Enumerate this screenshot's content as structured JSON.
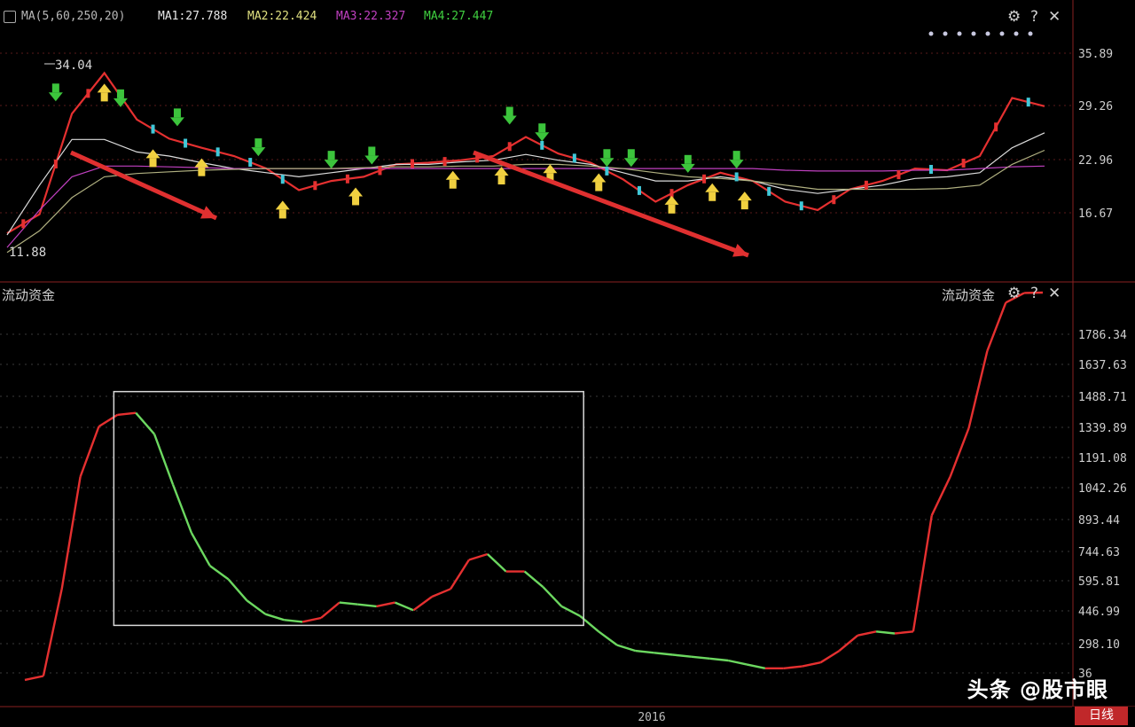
{
  "upper_panel": {
    "legend": [
      {
        "text": "MA(5,60,250,20)",
        "color": "#b8b8b8"
      },
      {
        "text": "MA1:27.788",
        "color": "#e8e8e8"
      },
      {
        "text": "MA2:22.424",
        "color": "#e0e080"
      },
      {
        "text": "MA3:22.327",
        "color": "#c040c0"
      },
      {
        "text": "MA4:27.447",
        "color": "#40d040"
      }
    ],
    "controls": {
      "settings": "⚙",
      "help": "?",
      "close": "✕"
    }
  },
  "lower_panel": {
    "indicator_left": "流动资金",
    "indicator_right": "流动资金",
    "controls": {
      "settings": "⚙",
      "help": "?",
      "close": "✕"
    }
  },
  "watermark": "头条 @股市眼",
  "bottom_tab": "日线",
  "chart_data": [
    {
      "type": "line",
      "panel": "price",
      "title": "",
      "y_ticks": [
        "35.89",
        "29.26",
        "22.96",
        "16.67"
      ],
      "annotations": [
        "34.04",
        "11.88"
      ],
      "x": [
        0,
        4,
        8,
        12,
        16,
        20,
        24,
        28,
        32,
        36,
        40,
        44,
        48,
        52,
        56,
        60,
        64,
        68,
        72,
        76,
        80,
        84,
        88,
        92,
        96,
        100,
        104,
        108,
        112,
        116,
        120,
        124,
        128
      ],
      "series": [
        {
          "values": [
            14.2,
            16.5,
            28.6,
            33.5,
            27.9,
            25.6,
            24.5,
            23.5,
            22.0,
            19.4,
            20.5,
            21.0,
            22.5,
            22.7,
            23.0,
            23.5,
            25.8,
            23.8,
            22.7,
            20.7,
            18.0,
            20.0,
            21.5,
            20.5,
            18.0,
            17.0,
            19.5,
            20.5,
            22.0,
            21.8,
            23.5,
            30.5,
            29.5
          ],
          "color": "#e53030"
        },
        {
          "values": [
            14.0,
            20.0,
            25.5,
            25.5,
            24.0,
            23.5,
            22.7,
            22.0,
            21.5,
            21.0,
            21.5,
            22.0,
            22.5,
            22.5,
            22.8,
            23.0,
            23.7,
            23.0,
            22.5,
            21.5,
            20.5,
            20.5,
            21.0,
            20.5,
            19.5,
            19.0,
            19.5,
            20.0,
            20.8,
            21.0,
            21.5,
            24.5,
            26.3
          ],
          "color": "#dcdcdc"
        },
        {
          "values": [
            12.5,
            17.0,
            21.0,
            22.3,
            22.3,
            22.2,
            22.1,
            22.0,
            22.0,
            22.0,
            22.0,
            22.0,
            22.0,
            22.0,
            22.0,
            22.0,
            22.0,
            22.0,
            22.0,
            22.0,
            22.0,
            22.0,
            22.0,
            22.0,
            21.8,
            21.7,
            21.7,
            21.7,
            21.8,
            21.8,
            22.0,
            22.2,
            22.3
          ],
          "color": "#c040c0"
        },
        {
          "values": [
            11.9,
            14.5,
            18.5,
            21.0,
            21.4,
            21.6,
            21.8,
            21.9,
            22.0,
            22.0,
            22.0,
            22.1,
            22.2,
            22.2,
            22.3,
            22.3,
            22.5,
            22.5,
            22.3,
            22.0,
            21.5,
            21.0,
            20.8,
            20.5,
            20.0,
            19.5,
            19.5,
            19.5,
            19.5,
            19.6,
            20.0,
            22.5,
            24.2
          ],
          "color": "#b0b080"
        }
      ],
      "signals": {
        "sell_x": [
          6,
          14,
          21,
          31,
          40,
          45,
          62,
          66,
          74,
          77,
          84,
          90
        ],
        "buy_x": [
          12,
          18,
          24,
          34,
          43,
          55,
          61,
          67,
          73,
          82,
          87,
          91
        ]
      }
    },
    {
      "type": "line",
      "panel": "indicator",
      "title": "流动资金",
      "y_ticks": [
        "1786.34",
        "1637.63",
        "1488.71",
        "1339.89",
        "1191.08",
        "1042.26",
        "893.44",
        "744.63",
        "595.81",
        "446.99",
        "298.10",
        "36"
      ],
      "x_ticks": [
        "2016"
      ],
      "x": [
        0,
        2,
        4,
        6,
        8,
        10,
        12,
        14,
        16,
        18,
        20,
        22,
        24,
        26,
        28,
        30,
        32,
        34,
        36,
        38,
        40,
        42,
        44,
        46,
        48,
        50,
        52,
        54,
        56,
        58,
        60,
        62,
        64,
        66,
        68,
        70,
        72,
        74,
        76,
        78,
        80,
        82,
        84,
        86,
        88,
        90,
        92,
        94,
        96,
        98,
        100,
        102,
        104,
        106,
        108,
        110
      ],
      "values": [
        0,
        20,
        470,
        1050,
        1310,
        1370,
        1380,
        1270,
        1010,
        760,
        590,
        520,
        410,
        340,
        310,
        300,
        320,
        400,
        390,
        380,
        400,
        360,
        430,
        470,
        620,
        650,
        560,
        560,
        480,
        380,
        330,
        250,
        180,
        150,
        140,
        130,
        120,
        110,
        100,
        80,
        60,
        60,
        70,
        90,
        150,
        230,
        250,
        240,
        250,
        850,
        1050,
        1300,
        1700,
        1950,
        2000,
        2060
      ],
      "highlight_ranges": [
        [
          5,
          30
        ],
        [
          51,
          92
        ]
      ]
    }
  ]
}
